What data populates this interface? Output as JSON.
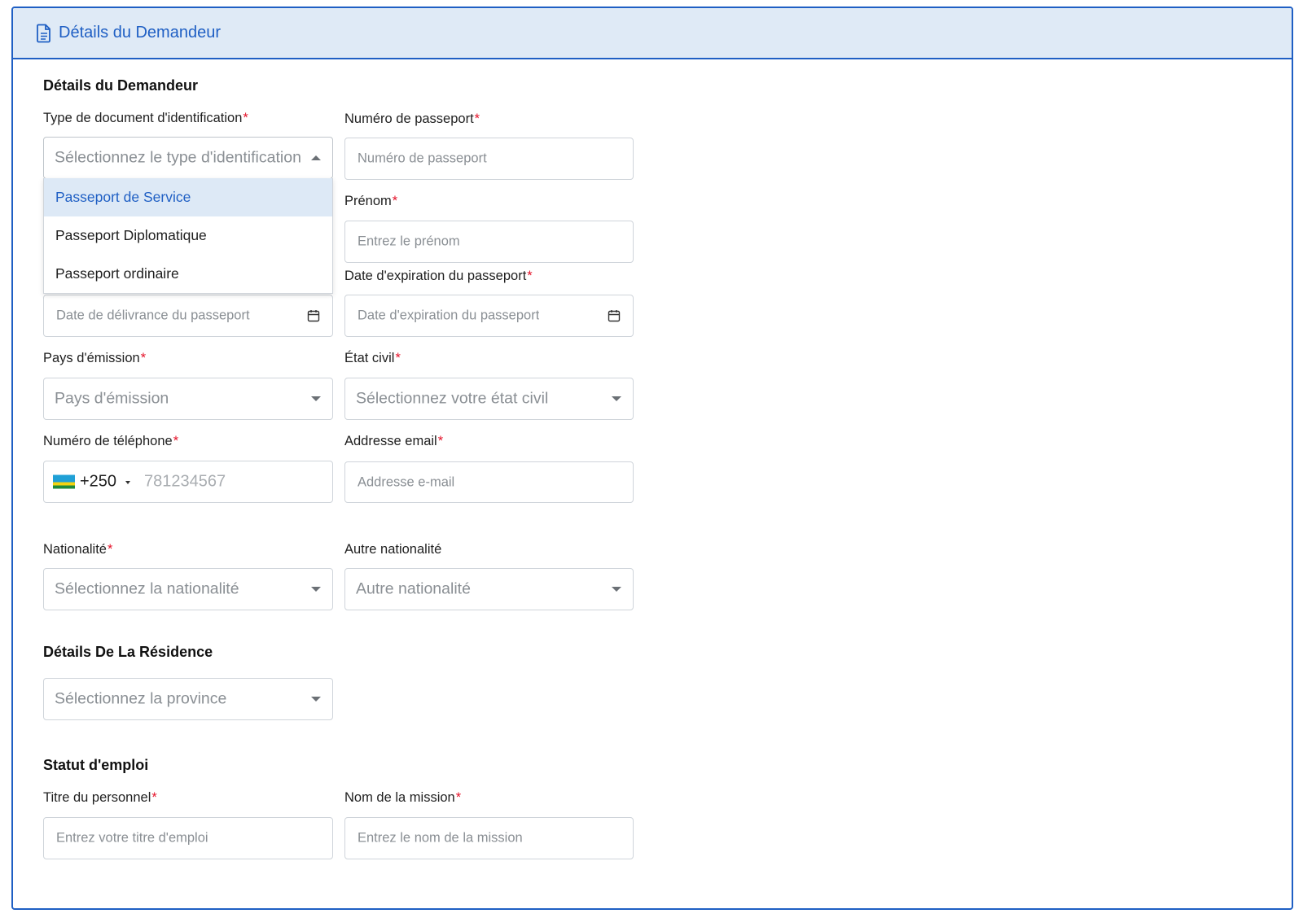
{
  "header": {
    "title": "Détails du Demandeur",
    "icon": "document-icon"
  },
  "applicant": {
    "section_title": "Détails du Demandeur",
    "id_type": {
      "label": "Type de document d'identification",
      "required": "*",
      "placeholder": "Sélectionnez le type d'identification",
      "open": true,
      "options": [
        "Passeport de Service",
        "Passeport Diplomatique",
        "Passeport ordinaire"
      ],
      "highlighted_option": "Passeport de Service"
    },
    "passport_number": {
      "label": "Numéro de passeport",
      "required": "*",
      "placeholder": "Numéro de passeport"
    },
    "first_name": {
      "label": "Prénom",
      "required": "*",
      "placeholder": "Entrez le prénom"
    },
    "issue_date": {
      "placeholder": "Date de délivrance du passeport"
    },
    "expiry_date": {
      "label": "Date d'expiration du passeport",
      "required": "*",
      "placeholder": "Date d'expiration du passeport"
    },
    "issuing_country": {
      "label": "Pays d'émission",
      "required": "*",
      "placeholder": "Pays d'émission"
    },
    "civil_status": {
      "label": "État civil",
      "required": "*",
      "placeholder": "Sélectionnez votre état civil"
    },
    "phone": {
      "label": "Numéro de téléphone",
      "required": "*",
      "country_code": "+250",
      "placeholder": "781234567",
      "flag": "rwanda-flag-icon"
    },
    "email": {
      "label": "Addresse email",
      "required": "*",
      "placeholder": "Addresse e-mail"
    },
    "nationality": {
      "label": "Nationalité",
      "required": "*",
      "placeholder": "Sélectionnez la nationalité"
    },
    "other_nationality": {
      "label": "Autre nationalité",
      "placeholder": "Autre nationalité"
    }
  },
  "residence": {
    "section_title": "Détails De La Résidence",
    "province": {
      "placeholder": "Sélectionnez la province"
    }
  },
  "employment": {
    "section_title": "Statut d'emploi",
    "job_title": {
      "label": "Titre du personnel",
      "required": "*",
      "placeholder": "Entrez votre titre d'emploi"
    },
    "mission_name": {
      "label": "Nom de la mission",
      "required": "*",
      "placeholder": "Entrez le nom de la mission"
    }
  },
  "colors": {
    "accent": "#1f5fc4",
    "header_bg": "#dfeaf6",
    "required": "#e5132a",
    "option_highlight_bg": "#dde9f6"
  }
}
